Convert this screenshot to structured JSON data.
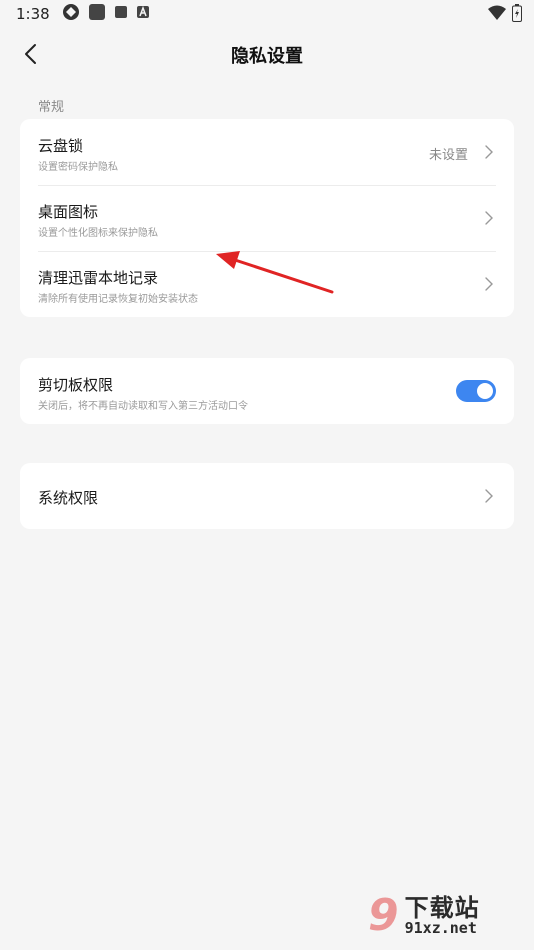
{
  "status_bar": {
    "time": "1:38",
    "icons_left": [
      "app-icon-1",
      "app-icon-2",
      "app-icon-3",
      "app-icon-4"
    ],
    "icons_right": [
      "wifi-icon",
      "battery-icon"
    ]
  },
  "header": {
    "title": "隐私设置",
    "back_icon": "back-arrow-icon"
  },
  "section": {
    "general_label": "常规"
  },
  "card1": {
    "rows": [
      {
        "title": "云盘锁",
        "subtitle": "设置密码保护隐私",
        "value": "未设置"
      },
      {
        "title": "桌面图标",
        "subtitle": "设置个性化图标来保护隐私"
      },
      {
        "title": "清理迅雷本地记录",
        "subtitle": "清除所有使用记录恢复初始安装状态"
      }
    ]
  },
  "card2": {
    "title": "剪切板权限",
    "subtitle": "关闭后，将不再自动读取和写入第三方活动口令",
    "toggle_on": true
  },
  "card3": {
    "title": "系统权限"
  },
  "watermark": {
    "logo": "9",
    "cn": "下载站",
    "en": "91xz.net"
  },
  "colors": {
    "accent": "#3d86f0",
    "background": "#f5f5f5",
    "card": "#ffffff",
    "annotation_arrow": "#e02424"
  }
}
